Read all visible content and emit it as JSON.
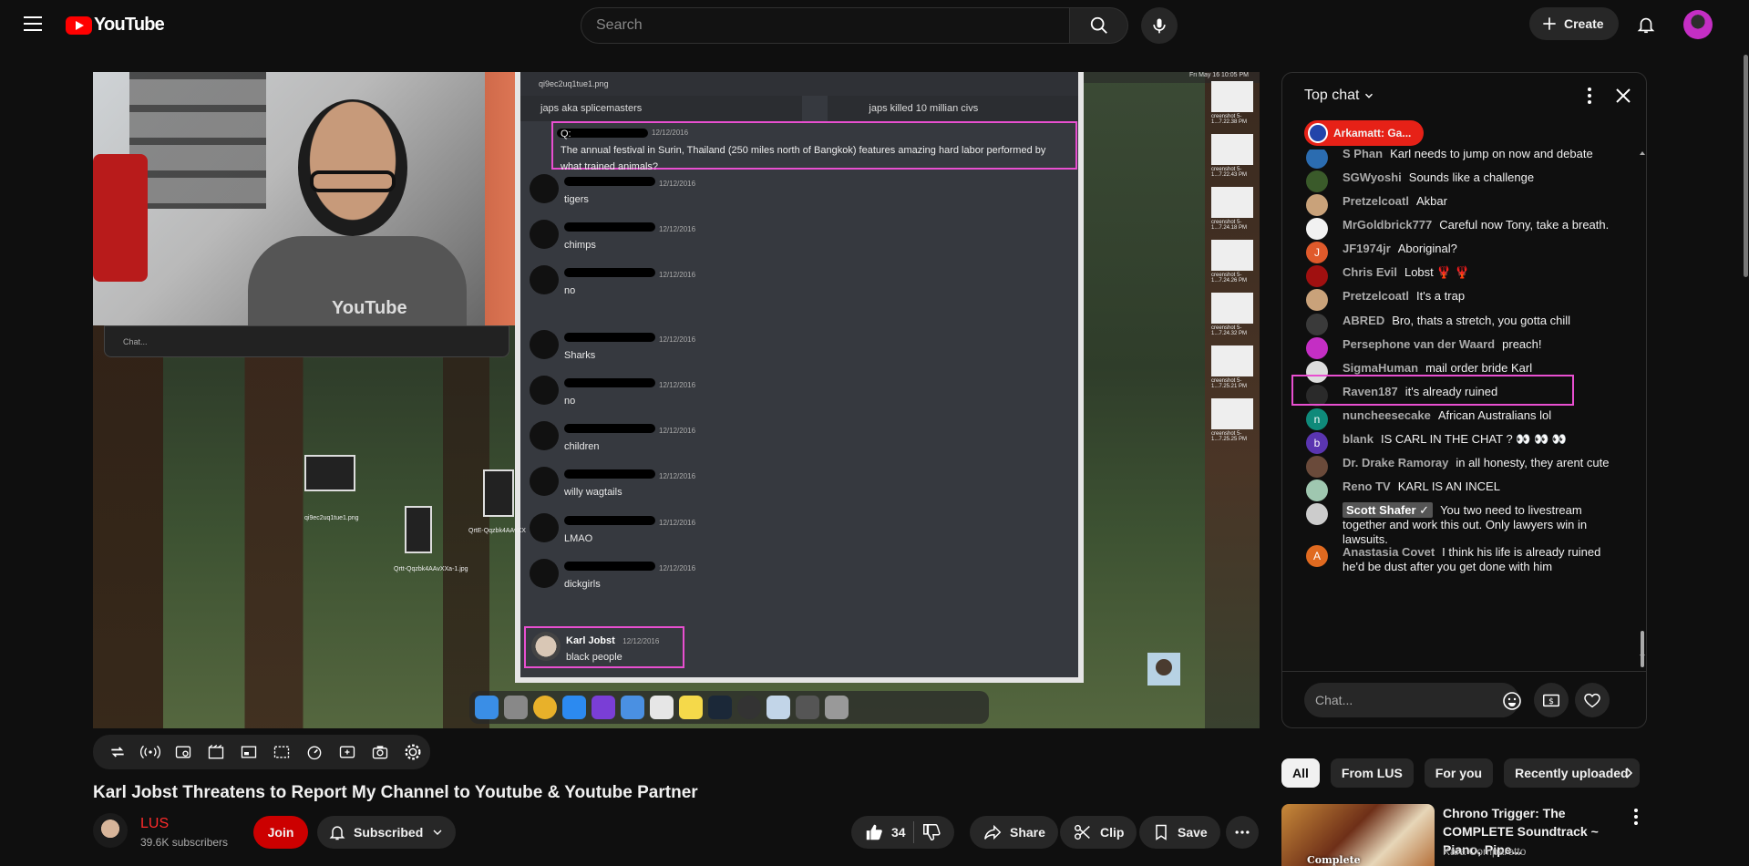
{
  "header": {
    "logo_text": "YouTube",
    "search_placeholder": "Search",
    "create_label": "Create"
  },
  "player": {
    "screen": {
      "file_name": "qi9ec2uq1tue1.png",
      "top_left_msg": "japs aka splicemasters",
      "top_right_msg": "japs killed 10 millian civs",
      "question_label": "Q:",
      "question_text": "The annual festival in Surin, Thailand (250 miles north of Bangkok) features amazing hard labor performed by what trained animals?",
      "messages": [
        {
          "date": "12/12/2016",
          "text": "tigers"
        },
        {
          "date": "12/12/2016",
          "text": "chimps"
        },
        {
          "date": "12/12/2016",
          "text": "no"
        },
        {
          "date": "12/12/2016",
          "text": "Sharks"
        },
        {
          "date": "12/12/2016",
          "text": "no"
        },
        {
          "date": "12/12/2016",
          "text": "children"
        },
        {
          "date": "12/12/2016",
          "text": "willy wagtails"
        },
        {
          "date": "12/12/2016",
          "text": "LMAO"
        },
        {
          "date": "12/12/2016",
          "text": "dickgirls"
        }
      ],
      "question_date": "12/12/2016",
      "highlight_author": "Karl Jobst",
      "highlight_date": "12/12/2016",
      "highlight_text": "black people",
      "mini_chat_placeholder": "Chat...",
      "desktop_icon_1": "qi9ec2uq1tue1.png",
      "desktop_icon_2": "Qrtt-Qqzbk4AAvXXa-1.jpg",
      "desktop_icon_3": "QrtE-Qqzbk4AAvXX",
      "shirt_logo": "YouTube",
      "mac_clock": "Fri May 16  10:05 PM",
      "thumb_labels": [
        "creenshot 5-1...7.22.38 PM",
        "creenshot 5-1...7.22.43 PM",
        "creenshot 5-1...7.24.18 PM",
        "creenshot 5-1...7.24.26 PM",
        "creenshot 5-1...7.24.32 PM",
        "creenshot 5-1...7.25.21 PM",
        "creenshot 5-1...7.25.25 PM"
      ]
    }
  },
  "video": {
    "title": "Karl Jobst Threatens to Report My Channel to Youtube & Youtube Partner",
    "channel_name": "LUS",
    "subscribers": "39.6K subscribers",
    "join_label": "Join",
    "subscribed_label": "Subscribed",
    "like_count": "34",
    "share_label": "Share",
    "clip_label": "Clip",
    "save_label": "Save"
  },
  "chat": {
    "title": "Top chat",
    "pinned_label": "Arkamatt: Ga...",
    "input_placeholder": "Chat...",
    "messages": [
      {
        "author": "S Phan",
        "text": "Karl needs to jump on now and debate",
        "color": "#2b6cb0"
      },
      {
        "author": "SGWyoshi",
        "text": "Sounds like a challenge",
        "color": "#3a5a2a"
      },
      {
        "author": "Pretzelcoatl",
        "text": "Akbar",
        "color": "#c9a27a"
      },
      {
        "author": "MrGoldbrick777",
        "text": "Careful now Tony, take a breath.",
        "color": "#f1f1f1"
      },
      {
        "author": "JF1974jr",
        "text": "Aboriginal?",
        "color": "#e05a2b",
        "initial": "J"
      },
      {
        "author": "Chris Evil",
        "text": "Lobst 🦞 🦞",
        "color": "#a01010"
      },
      {
        "author": "Pretzelcoatl",
        "text": "It's a trap",
        "color": "#c9a27a"
      },
      {
        "author": "ABRED",
        "text": "Bro, thats a stretch, you gotta chill",
        "color": "#3a3a3a"
      },
      {
        "author": "Persephone van der Waard",
        "text": "preach!",
        "color": "#c42ec4"
      },
      {
        "author": "SigmaHuman",
        "text": "mail order bride Karl",
        "color": "#dddddd"
      },
      {
        "author": "Raven187",
        "text": "it's already ruined",
        "color": "#2a2a2a"
      },
      {
        "author": "nuncheesecake",
        "text": "African Australians lol",
        "color": "#0f8a7a",
        "initial": "n"
      },
      {
        "author": "blank",
        "text": "IS CARL IN THE CHAT ? 👀 👀 👀",
        "color": "#5a35b0",
        "initial": "b"
      },
      {
        "author": "Dr. Drake Ramoray",
        "text": "in all honesty, they arent cute",
        "color": "#6a4a3a"
      },
      {
        "author": "Reno TV",
        "text": "KARL IS AN INCEL",
        "color": "#9fc7b0"
      },
      {
        "author": "Scott Shafer ✓",
        "text": "You two need to livestream together and work this out. Only lawyers win in lawsuits.",
        "color": "#ccc"
      },
      {
        "author": "Anastasia Covet",
        "text": "I think his life is already ruined he'd be dust after you get done with him",
        "color": "#e06a20",
        "initial": "A"
      }
    ]
  },
  "chips": [
    "All",
    "From LUS",
    "For you",
    "Recently uploaded"
  ],
  "recommendation": {
    "title": "Chrono Trigger: The COMPLETE Soundtrack ~ Piano, Pipe...",
    "channel": "Kara Comparetto",
    "thumb_label": "Complete"
  }
}
